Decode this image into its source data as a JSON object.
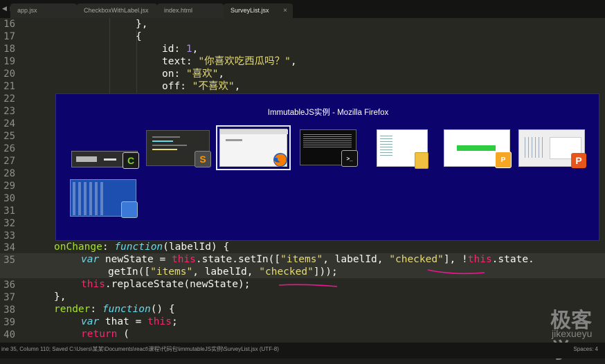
{
  "tabs": [
    {
      "label": "app.jsx",
      "active": false
    },
    {
      "label": "CheckboxWithLabel.jsx",
      "active": false
    },
    {
      "label": "index.html",
      "active": false
    },
    {
      "label": "SurveyList.jsx",
      "active": true
    }
  ],
  "tab_close": "×",
  "tab_nav": "◀ ▶",
  "line_numbers": [
    "16",
    "17",
    "18",
    "19",
    "20",
    "21",
    "22",
    "23",
    "24",
    "25",
    "26",
    "27",
    "28",
    "29",
    "30",
    "31",
    "32",
    "33",
    "34",
    "35",
    "",
    "36",
    "37",
    "38",
    "39",
    "40"
  ],
  "code": {
    "l16": "},",
    "l17": "{",
    "l18_key": "id: ",
    "l18_val": "1",
    "l19_key": "text: ",
    "l19_val": "\"你喜欢吃西瓜吗？\"",
    "l20_key": "on: ",
    "l20_val": "\"喜欢\"",
    "l21_key": "off: ",
    "l21_val": "\"不喜欢\"",
    "l34_a": "onChange",
    "l34_b": ": ",
    "l34_c": "function",
    "l34_d": "(labelId) {",
    "l35_a": "var",
    "l35_b": " newState = ",
    "l35_c": "this",
    "l35_d": ".state.setIn([",
    "l35_e": "\"items\"",
    "l35_f": ", labelId, ",
    "l35_g": "\"checked\"",
    "l35_h": "], !",
    "l35_i": "this",
    "l35_j": ".state.",
    "l35w_a": "getIn([",
    "l35w_b": "\"items\"",
    "l35w_c": ", labelId, ",
    "l35w_d": "\"checked\"",
    "l35w_e": "]));",
    "l36_a": "this",
    "l36_b": ".replaceState(newState);",
    "l37": "},",
    "l38_a": "render",
    "l38_b": ": ",
    "l38_c": "function",
    "l38_d": "() {",
    "l39_a": "var",
    "l39_b": " that = ",
    "l39_c": "this",
    "l39_d": ";",
    "l40_a": "return",
    "l40_b": " ("
  },
  "switcher": {
    "title": "ImmutableJS实例 - Mozilla Firefox",
    "windows": [
      {
        "name": "camtasia-recorder",
        "badge": "C"
      },
      {
        "name": "sublime-text",
        "badge": "S"
      },
      {
        "name": "firefox",
        "badge": ""
      },
      {
        "name": "terminal",
        "badge": ">_"
      },
      {
        "name": "file-explorer",
        "badge": ""
      },
      {
        "name": "web-page",
        "badge": ""
      },
      {
        "name": "powerpoint-doc",
        "badge": "P"
      },
      {
        "name": "presentation",
        "badge": "P"
      },
      {
        "name": "desktop",
        "badge": ""
      }
    ]
  },
  "status": {
    "left": "ine 35, Column 110; Saved C:\\Users\\某某\\Documents\\react\\课程\\代码包\\immutableJS实例\\SurveyList.jsx (UTF-8)",
    "right": "Spaces: 4"
  },
  "watermark": {
    "cn": "极客学",
    "en": "jikexueyu"
  },
  "colors": {
    "keyword": "#66d9ef",
    "function_name": "#a6e22e",
    "string": "#e6db74",
    "number": "#ae81ff",
    "this": "#f92672",
    "annotation": "#e8188f",
    "switcher_bg": "#0d036d"
  }
}
